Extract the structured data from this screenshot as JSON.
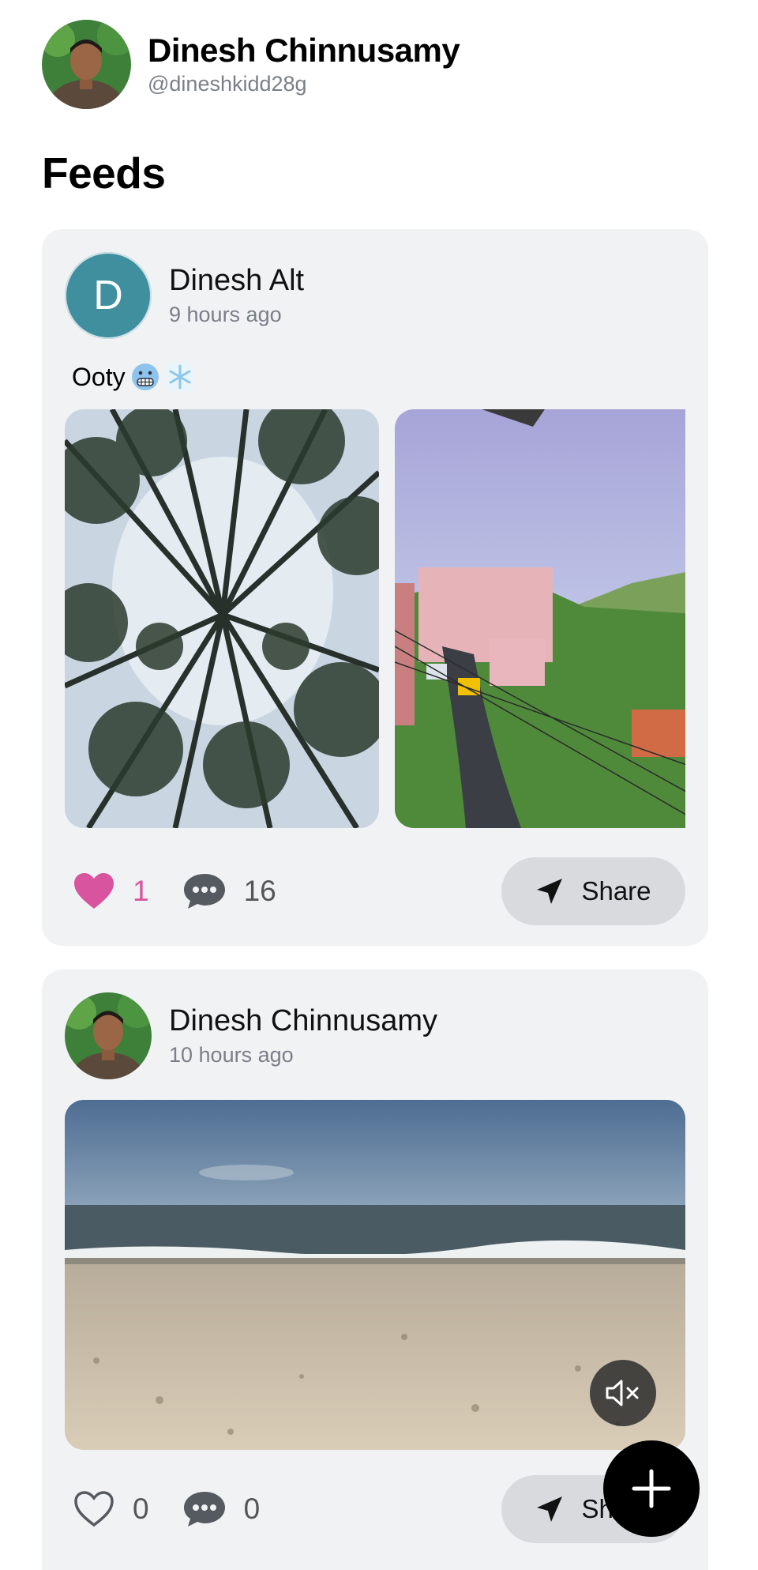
{
  "profile": {
    "name": "Dinesh Chinnusamy",
    "handle": "@dineshkidd28g"
  },
  "feeds_title": "Feeds",
  "posts": [
    {
      "author": "Dinesh Alt",
      "avatar_letter": "D",
      "time": "9 hours ago",
      "text": "Ooty",
      "text_emojis": [
        "grimacing-face",
        "snowflake"
      ],
      "media": [
        "forest-canopy-photo",
        "hillside-town-photo"
      ],
      "liked": true,
      "likes": "1",
      "comments": "16",
      "share_label": "Share"
    },
    {
      "author": "Dinesh Chinnusamy",
      "time": "10 hours ago",
      "media": [
        "beach-video"
      ],
      "liked": false,
      "likes": "0",
      "comments": "0",
      "share_label": "Share"
    }
  ],
  "colors": {
    "like_pink": "#d9549e",
    "card_bg": "#f1f2f4",
    "muted_text": "#7a7f87",
    "avatar_teal": "#3f8f9e"
  }
}
